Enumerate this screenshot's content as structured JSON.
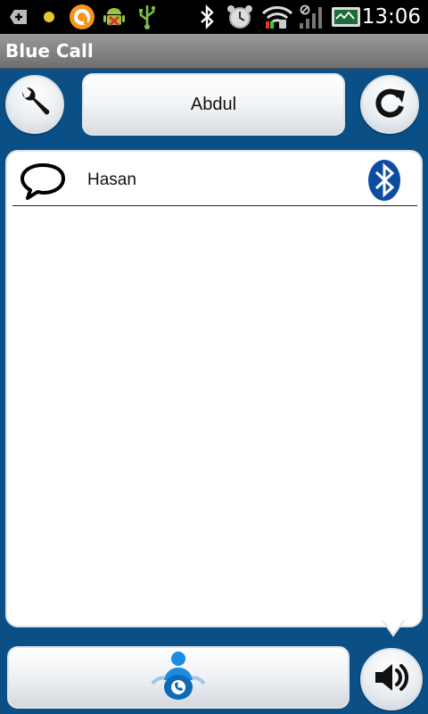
{
  "status_bar": {
    "time": "13:06",
    "icons": [
      "add-icon",
      "notification-dot-icon",
      "orange-app-icon",
      "android-debug-icon",
      "usb-icon",
      "bluetooth-icon",
      "alarm-clock-icon",
      "wifi-icon",
      "signal-strength-icon",
      "battery-icon"
    ]
  },
  "app": {
    "title": "Blue Call"
  },
  "toolbar": {
    "contact_name": "Abdul",
    "settings_icon": "wrench-icon",
    "refresh_icon": "refresh-icon"
  },
  "device_list": {
    "items": [
      {
        "label": "Hasan",
        "icon": "chat-bubble-icon",
        "status_icon": "bluetooth-icon"
      }
    ]
  },
  "bottom": {
    "call_icon": "contact-call-icon",
    "speaker_icon": "speaker-icon"
  },
  "colors": {
    "background": "#0a4f86",
    "bluetooth": "#0d4da1"
  }
}
